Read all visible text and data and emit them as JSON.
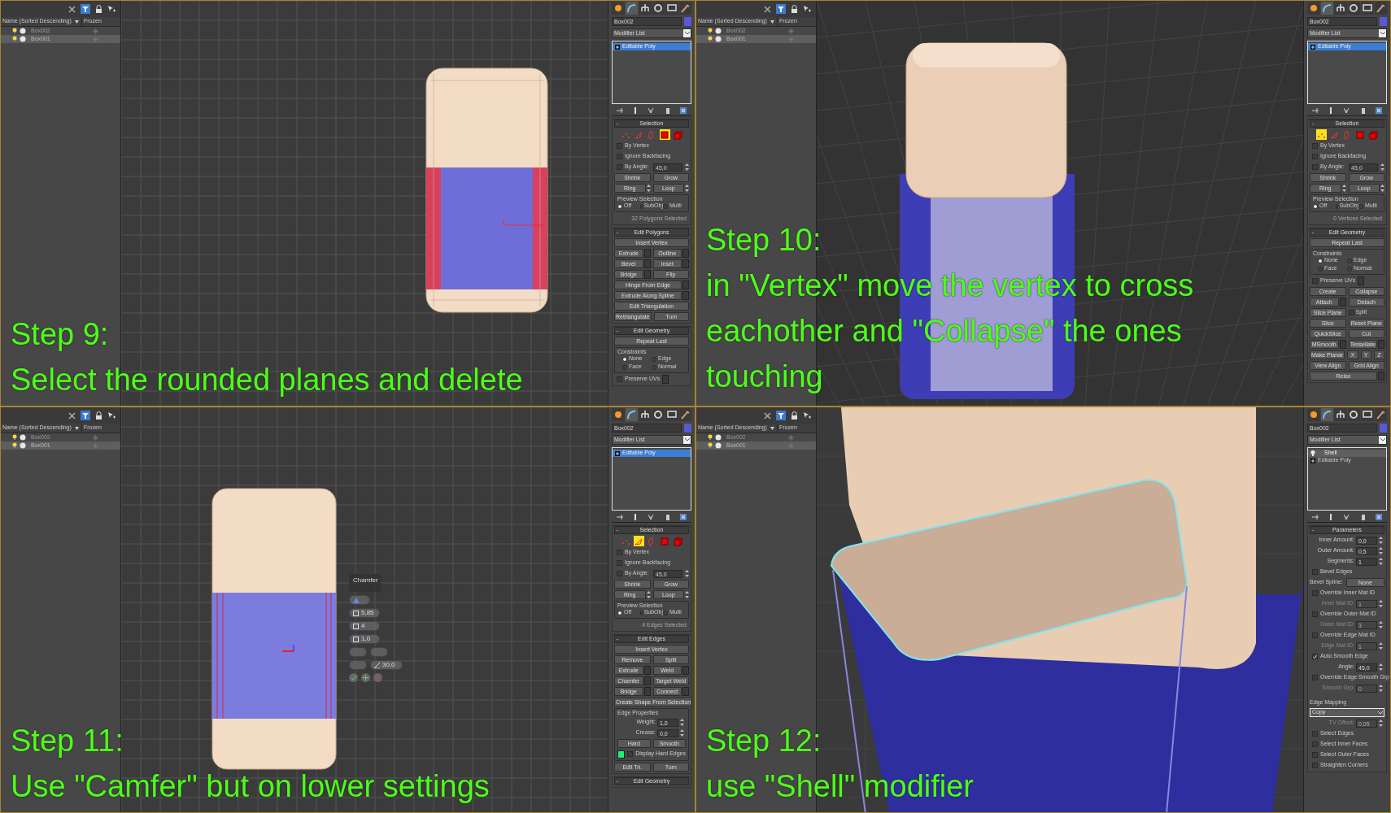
{
  "quadrants": [
    {
      "kind": "front",
      "explorer": {
        "heading": "Name (Sorted Descending)",
        "column": "Frozen",
        "rows": [
          {
            "label": "Box002",
            "selected": false
          },
          {
            "label": "Box001",
            "selected": true
          }
        ]
      },
      "caption": {
        "title": "Step 9:",
        "lines": [
          "Select the rounded planes and delete"
        ]
      },
      "panel": {
        "tabs": [
          {
            "selected": false
          },
          {
            "selected": true
          },
          {
            "selected": false
          },
          {
            "selected": false
          },
          {
            "selected": false
          },
          {
            "selected": false
          }
        ],
        "object_name": "Box002",
        "modifier_list": "Modifier List",
        "stack": [
          {
            "label": "Editable Poly",
            "selected": true
          }
        ],
        "rollouts": [
          {
            "sign": "-",
            "title": "Selection",
            "controls": [
              {
                "kind": "levels",
                "items": [
                  {
                    "selected": false
                  },
                  {
                    "selected": false
                  },
                  {
                    "selected": false
                  },
                  {
                    "selected": true
                  },
                  {
                    "selected": false
                  }
                ]
              },
              {
                "kind": "check",
                "label": "By Vertex",
                "checked": false
              },
              {
                "kind": "check",
                "label": "Ignore Backfacing",
                "checked": false
              },
              {
                "kind": "check",
                "label": "By Angle:",
                "checked": false,
                "value": "45,0"
              },
              {
                "kind": "buttons",
                "items": [
                  {
                    "label": "Shrink"
                  },
                  {
                    "label": "Grow"
                  }
                ]
              },
              {
                "kind": "buttons",
                "items": [
                  {
                    "label": "Ring",
                    "spinner": true
                  },
                  {
                    "label": "Loop",
                    "spinner": true
                  }
                ]
              },
              {
                "kind": "radios",
                "title": "Preview Selection",
                "items": [
                  {
                    "label": "Off",
                    "selected": true
                  },
                  {
                    "label": "SubObj",
                    "selected": false
                  },
                  {
                    "label": "Multi",
                    "selected": false
                  }
                ]
              },
              {
                "kind": "note",
                "text": "32 Polygons Selected"
              }
            ]
          },
          {
            "sign": "-",
            "title": "Edit Polygons",
            "controls": [
              {
                "kind": "buttons",
                "items": [
                  {
                    "label": "Insert Vertex"
                  }
                ]
              },
              {
                "kind": "buttons",
                "items": [
                  {
                    "label": "Extrude",
                    "settings": true
                  },
                  {
                    "label": "Outline",
                    "settings": true
                  }
                ]
              },
              {
                "kind": "buttons",
                "items": [
                  {
                    "label": "Bevel",
                    "settings": true
                  },
                  {
                    "label": "Inset",
                    "settings": true
                  }
                ]
              },
              {
                "kind": "buttons",
                "items": [
                  {
                    "label": "Bridge",
                    "settings": true
                  },
                  {
                    "label": "Flip"
                  }
                ]
              },
              {
                "kind": "buttons",
                "items": [
                  {
                    "label": "Hinge From Edge",
                    "settings": true
                  }
                ]
              },
              {
                "kind": "buttons",
                "items": [
                  {
                    "label": "Extrude Along Spline",
                    "settings": true
                  }
                ]
              },
              {
                "kind": "buttons",
                "items": [
                  {
                    "label": "Edit Triangulation"
                  }
                ]
              },
              {
                "kind": "buttons",
                "items": [
                  {
                    "label": "Retriangulate"
                  },
                  {
                    "label": "Turn"
                  }
                ]
              }
            ]
          },
          {
            "sign": "-",
            "title": "Edit Geometry",
            "controls": [
              {
                "kind": "buttons",
                "items": [
                  {
                    "label": "Repeat Last"
                  }
                ]
              },
              {
                "kind": "radios",
                "title": "Constraints",
                "items": [
                  {
                    "label": "None",
                    "selected": true
                  },
                  {
                    "label": "Edge",
                    "selected": false
                  },
                  {
                    "label": "Face",
                    "selected": false
                  },
                  {
                    "label": "Normal",
                    "selected": false
                  }
                ]
              },
              {
                "kind": "check",
                "label": "Preserve UVs",
                "checked": false,
                "settings": true
              }
            ]
          }
        ]
      }
    },
    {
      "kind": "perspective",
      "explorer": {
        "heading": "Name (Sorted Descending)",
        "column": "Frozen",
        "rows": [
          {
            "label": "Box002",
            "selected": false
          },
          {
            "label": "Box001",
            "selected": true
          }
        ]
      },
      "caption": {
        "title": "Step 10:",
        "lines": [
          "in \"Vertex\" move the vertex to cross",
          "eachother and \"Collapse\" the ones",
          "touching"
        ]
      },
      "panel": {
        "tabs": [
          {
            "selected": false
          },
          {
            "selected": true
          },
          {
            "selected": false
          },
          {
            "selected": false
          },
          {
            "selected": false
          },
          {
            "selected": false
          }
        ],
        "object_name": "Box002",
        "modifier_list": "Modifier List",
        "stack": [
          {
            "label": "Editable Poly",
            "selected": true
          }
        ],
        "rollouts": [
          {
            "sign": "-",
            "title": "Selection",
            "controls": [
              {
                "kind": "levels",
                "items": [
                  {
                    "selected": true
                  },
                  {
                    "selected": false
                  },
                  {
                    "selected": false
                  },
                  {
                    "selected": false
                  },
                  {
                    "selected": false
                  }
                ]
              },
              {
                "kind": "check",
                "label": "By Vertex",
                "checked": false
              },
              {
                "kind": "check",
                "label": "Ignore Backfacing",
                "checked": false
              },
              {
                "kind": "check",
                "label": "By Angle:",
                "checked": false,
                "value": "45,0"
              },
              {
                "kind": "buttons",
                "items": [
                  {
                    "label": "Shrink"
                  },
                  {
                    "label": "Grow"
                  }
                ]
              },
              {
                "kind": "buttons",
                "items": [
                  {
                    "label": "Ring",
                    "spinner": true
                  },
                  {
                    "label": "Loop",
                    "spinner": true
                  }
                ]
              },
              {
                "kind": "radios",
                "title": "Preview Selection",
                "items": [
                  {
                    "label": "Off",
                    "selected": true
                  },
                  {
                    "label": "SubObj",
                    "selected": false
                  },
                  {
                    "label": "Multi",
                    "selected": false
                  }
                ]
              },
              {
                "kind": "note",
                "text": "0 Vertices Selected"
              }
            ]
          },
          {
            "sign": "-",
            "title": "Edit Geometry",
            "controls": [
              {
                "kind": "buttons",
                "items": [
                  {
                    "label": "Repeat Last"
                  }
                ]
              },
              {
                "kind": "radios",
                "title": "Constraints",
                "items": [
                  {
                    "label": "None",
                    "selected": true
                  },
                  {
                    "label": "Edge",
                    "selected": false
                  },
                  {
                    "label": "Face",
                    "selected": false
                  },
                  {
                    "label": "Normal",
                    "selected": false
                  }
                ]
              },
              {
                "kind": "check",
                "label": "Preserve UVs",
                "checked": false,
                "settings": true
              },
              {
                "kind": "buttons",
                "items": [
                  {
                    "label": "Create"
                  },
                  {
                    "label": "Collapse"
                  }
                ]
              },
              {
                "kind": "buttons",
                "items": [
                  {
                    "label": "Attach",
                    "settings": true
                  },
                  {
                    "label": "Detach"
                  }
                ]
              },
              {
                "kind": "buttons",
                "items": [
                  {
                    "label": "Slice Plane"
                  }
                ],
                "check": {
                  "label": "Split",
                  "checked": false
                }
              },
              {
                "kind": "buttons",
                "items": [
                  {
                    "label": "Slice"
                  },
                  {
                    "label": "Reset Plane"
                  }
                ]
              },
              {
                "kind": "buttons",
                "items": [
                  {
                    "label": "QuickSlice"
                  },
                  {
                    "label": "Cut"
                  }
                ]
              },
              {
                "kind": "buttons",
                "items": [
                  {
                    "label": "MSmooth",
                    "settings": true
                  },
                  {
                    "label": "Tessellate",
                    "settings": true
                  }
                ]
              },
              {
                "kind": "buttons",
                "items": [
                  {
                    "label": "Make Planar"
                  },
                  {
                    "label": "X"
                  },
                  {
                    "label": "Y"
                  },
                  {
                    "label": "Z"
                  }
                ]
              },
              {
                "kind": "buttons",
                "items": [
                  {
                    "label": "View Align"
                  },
                  {
                    "label": "Grid Align"
                  }
                ]
              },
              {
                "kind": "buttons",
                "items": [
                  {
                    "label": "Relax",
                    "settings": true
                  }
                ]
              }
            ]
          }
        ]
      }
    },
    {
      "kind": "front_low",
      "explorer": {
        "heading": "Name (Sorted Descending)",
        "column": "Frozen",
        "rows": [
          {
            "label": "Box002",
            "selected": false
          },
          {
            "label": "Box001",
            "selected": true
          }
        ]
      },
      "caption": {
        "title": "Step 11:",
        "lines": [
          "Use \"Camfer\" but on lower settings"
        ]
      },
      "caddy": {
        "title": "Chamfer",
        "fields": [
          "5,85",
          "4",
          "1,0",
          "30,0"
        ]
      },
      "panel": {
        "tabs": [
          {
            "selected": false
          },
          {
            "selected": true
          },
          {
            "selected": false
          },
          {
            "selected": false
          },
          {
            "selected": false
          },
          {
            "selected": false
          }
        ],
        "object_name": "Box002",
        "modifier_list": "Modifier List",
        "stack": [
          {
            "label": "Editable Poly",
            "selected": true
          }
        ],
        "rollouts": [
          {
            "sign": "-",
            "title": "Selection",
            "controls": [
              {
                "kind": "levels",
                "items": [
                  {
                    "selected": false
                  },
                  {
                    "selected": true
                  },
                  {
                    "selected": false
                  },
                  {
                    "selected": false
                  },
                  {
                    "selected": false
                  }
                ]
              },
              {
                "kind": "check",
                "label": "By Vertex",
                "checked": false
              },
              {
                "kind": "check",
                "label": "Ignore Backfacing",
                "checked": false
              },
              {
                "kind": "check",
                "label": "By Angle:",
                "checked": false,
                "value": "45,0"
              },
              {
                "kind": "buttons",
                "items": [
                  {
                    "label": "Shrink"
                  },
                  {
                    "label": "Grow"
                  }
                ]
              },
              {
                "kind": "buttons",
                "items": [
                  {
                    "label": "Ring",
                    "spinner": true
                  },
                  {
                    "label": "Loop",
                    "spinner": true
                  }
                ]
              },
              {
                "kind": "radios",
                "title": "Preview Selection",
                "items": [
                  {
                    "label": "Off",
                    "selected": true
                  },
                  {
                    "label": "SubObj",
                    "selected": false
                  },
                  {
                    "label": "Multi",
                    "selected": false
                  }
                ]
              },
              {
                "kind": "note",
                "text": "4 Edges Selected"
              }
            ]
          },
          {
            "sign": "-",
            "title": "Edit Edges",
            "controls": [
              {
                "kind": "buttons",
                "items": [
                  {
                    "label": "Insert Vertex"
                  }
                ]
              },
              {
                "kind": "buttons",
                "items": [
                  {
                    "label": "Remove"
                  },
                  {
                    "label": "Split"
                  }
                ]
              },
              {
                "kind": "buttons",
                "items": [
                  {
                    "label": "Extrude",
                    "settings": true
                  },
                  {
                    "label": "Weld",
                    "settings": true
                  }
                ]
              },
              {
                "kind": "buttons",
                "items": [
                  {
                    "label": "Chamfer",
                    "settings": true
                  },
                  {
                    "label": "Target Weld"
                  }
                ]
              },
              {
                "kind": "buttons",
                "items": [
                  {
                    "label": "Bridge",
                    "settings": true
                  },
                  {
                    "label": "Connect",
                    "settings": true
                  }
                ]
              },
              {
                "kind": "buttons",
                "items": [
                  {
                    "label": "Create Shape From Selection"
                  }
                ]
              },
              {
                "kind": "group",
                "title": "Edge Properties",
                "controls": [
                  {
                    "kind": "spinner",
                    "label": "Weight:",
                    "value": "1,0",
                    "disabled": false
                  },
                  {
                    "kind": "spinner",
                    "label": "Crease:",
                    "value": "0,0",
                    "disabled": false
                  },
                  {
                    "kind": "buttons",
                    "items": [
                      {
                        "label": "Hard"
                      },
                      {
                        "label": "Smooth"
                      }
                    ]
                  },
                  {
                    "kind": "swatch_check",
                    "label": "Display Hard Edges",
                    "checked": false,
                    "color": "#19f27a"
                  }
                ]
              },
              {
                "kind": "buttons",
                "items": [
                  {
                    "label": "Edit Tri."
                  },
                  {
                    "label": "Turn"
                  }
                ]
              }
            ]
          },
          {
            "sign": "-",
            "title": "Edit Geometry"
          }
        ]
      }
    },
    {
      "kind": "closeup",
      "explorer": {
        "heading": "Name (Sorted Descending)",
        "column": "Frozen",
        "rows": [
          {
            "label": "Box002",
            "selected": false
          },
          {
            "label": "Box001",
            "selected": true
          }
        ]
      },
      "caption": {
        "title": "Step 12:",
        "lines": [
          "use \"Shell\" modifier"
        ]
      },
      "panel": {
        "tabs": [
          {
            "selected": false
          },
          {
            "selected": true
          },
          {
            "selected": false
          },
          {
            "selected": false
          },
          {
            "selected": false
          },
          {
            "selected": false
          }
        ],
        "object_name": "Box002",
        "modifier_list": "Modifier List",
        "stack": [
          {
            "label": "Shell",
            "selected": true,
            "kind": "modifier"
          },
          {
            "label": "Editable Poly",
            "selected": false,
            "kind": "base"
          }
        ],
        "rollouts": [
          {
            "sign": "-",
            "title": "Parameters",
            "controls": [
              {
                "kind": "spinner",
                "label": "Inner Amount:",
                "value": "0,0",
                "disabled": false
              },
              {
                "kind": "spinner",
                "label": "Outer Amount:",
                "value": "0,5",
                "disabled": false
              },
              {
                "kind": "spinner",
                "label": "Segments:",
                "value": "1",
                "disabled": false
              },
              {
                "kind": "check",
                "label": "Bevel Edges",
                "checked": false
              },
              {
                "kind": "labeled_button",
                "label": "Bevel Spline:",
                "value": "None"
              },
              {
                "kind": "check",
                "label": "Override Inner Mat ID",
                "checked": false
              },
              {
                "kind": "spinner",
                "label": "Inner Mat ID:",
                "value": "1",
                "disabled": true
              },
              {
                "kind": "check",
                "label": "Override Outer Mat ID",
                "checked": false
              },
              {
                "kind": "spinner",
                "label": "Outer Mat ID:",
                "value": "3",
                "disabled": true
              },
              {
                "kind": "check",
                "label": "Override Edge Mat ID",
                "checked": false
              },
              {
                "kind": "spinner",
                "label": "Edge Mat ID:",
                "value": "1",
                "disabled": true
              },
              {
                "kind": "check",
                "label": "Auto Smooth Edge",
                "checked": true
              },
              {
                "kind": "spinner",
                "label": "Angle:",
                "value": "45,0",
                "disabled": false
              },
              {
                "kind": "check",
                "label": "Override Edge Smooth Grp",
                "checked": false
              },
              {
                "kind": "spinner",
                "label": "Smooth Grp:",
                "value": "0",
                "disabled": true
              },
              {
                "kind": "label",
                "text": "Edge Mapping"
              },
              {
                "kind": "dropdown",
                "value": "Copy"
              },
              {
                "kind": "spinner",
                "label": "TV Offset:",
                "value": "0,05",
                "disabled": true
              },
              {
                "kind": "check",
                "label": "Select Edges",
                "checked": false
              },
              {
                "kind": "check",
                "label": "Select Inner Faces",
                "checked": false
              },
              {
                "kind": "check",
                "label": "Select Outer Faces",
                "checked": false
              },
              {
                "kind": "check",
                "label": "Straighten Corners",
                "checked": false
              }
            ]
          }
        ]
      }
    }
  ]
}
